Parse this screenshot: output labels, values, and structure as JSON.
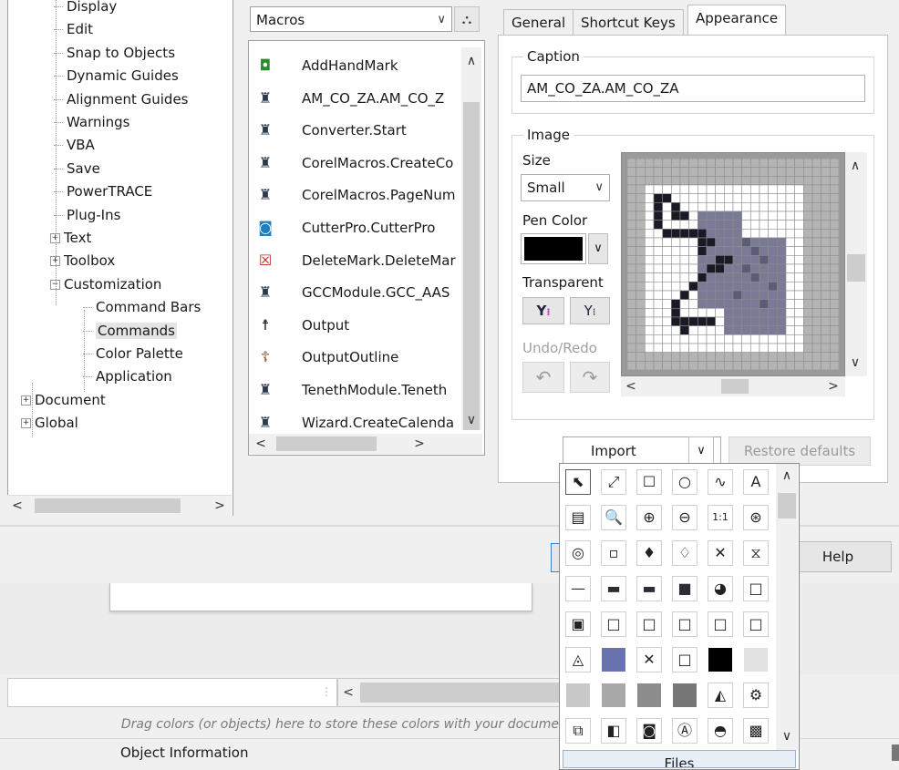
{
  "tree": {
    "items": [
      {
        "label": "Display",
        "level": 1
      },
      {
        "label": "Edit",
        "level": 1
      },
      {
        "label": "Snap to Objects",
        "level": 1
      },
      {
        "label": "Dynamic Guides",
        "level": 1
      },
      {
        "label": "Alignment Guides",
        "level": 1
      },
      {
        "label": "Warnings",
        "level": 1
      },
      {
        "label": "VBA",
        "level": 1
      },
      {
        "label": "Save",
        "level": 1
      },
      {
        "label": "PowerTRACE",
        "level": 1
      },
      {
        "label": "Plug-Ins",
        "level": 1
      },
      {
        "label": "Text",
        "level": 1,
        "expander": "+"
      },
      {
        "label": "Toolbox",
        "level": 1,
        "expander": "+"
      },
      {
        "label": "Customization",
        "level": 1,
        "expander": "−"
      },
      {
        "label": "Command Bars",
        "level": 2
      },
      {
        "label": "Commands",
        "level": 2,
        "selected": true
      },
      {
        "label": "Color Palette",
        "level": 2
      },
      {
        "label": "Application",
        "level": 2
      },
      {
        "label": "Document",
        "level": 0,
        "expander": "+"
      },
      {
        "label": "Global",
        "level": 0,
        "expander": "+"
      }
    ]
  },
  "macros": {
    "category": "Macros",
    "items": [
      {
        "label": "AddHandMark",
        "icon": "hand-mark-icon",
        "glyph": "◘",
        "color": "#2d8a2d"
      },
      {
        "label": "AM_CO_ZA.AM_CO_Z",
        "icon": "macro-runner-icon",
        "glyph": "♜",
        "color": "#2a3a4a"
      },
      {
        "label": "Converter.Start",
        "icon": "macro-runner-icon",
        "glyph": "♜",
        "color": "#2a3a4a"
      },
      {
        "label": "CorelMacros.CreateCo",
        "icon": "macro-runner-icon",
        "glyph": "♜",
        "color": "#2a3a4a"
      },
      {
        "label": "CorelMacros.PageNum",
        "icon": "macro-runner-icon",
        "glyph": "♜",
        "color": "#2a3a4a"
      },
      {
        "label": "CutterPro.CutterPro",
        "icon": "cutter-icon",
        "glyph": "◙",
        "color": "#1f7fbf"
      },
      {
        "label": "DeleteMark.DeleteMar",
        "icon": "delete-mark-icon",
        "glyph": "☒",
        "color": "#c02020"
      },
      {
        "label": "GCCModule.GCC_AAS",
        "icon": "macro-runner-icon",
        "glyph": "♜",
        "color": "#2a3a4a"
      },
      {
        "label": "Output",
        "icon": "output-icon",
        "glyph": "☨",
        "color": "#222222"
      },
      {
        "label": "OutputOutline",
        "icon": "output-outline-icon",
        "glyph": "☦",
        "color": "#8a4a20"
      },
      {
        "label": "TenethModule.Teneth",
        "icon": "macro-runner-icon",
        "glyph": "♜",
        "color": "#2a3a4a"
      },
      {
        "label": "Wizard.CreateCalenda",
        "icon": "macro-runner-icon",
        "glyph": "♜",
        "color": "#2a3a4a"
      }
    ]
  },
  "tabs": [
    {
      "label": "General"
    },
    {
      "label": "Shortcut Keys"
    },
    {
      "label": "Appearance",
      "active": true
    }
  ],
  "appearance": {
    "caption_legend": "Caption",
    "caption_value": "AM_CO_ZA.AM_CO_ZA",
    "image_legend": "Image",
    "size_label": "Size",
    "size_value": "Small",
    "pen_color_label": "Pen Color",
    "pen_color": "#000000",
    "transparent_label": "Transparent",
    "undo_redo_label": "Undo/Redo",
    "import_label": "Import",
    "restore_label": "Restore defaults"
  },
  "dialog": {
    "help_label": "Help"
  },
  "popup": {
    "files_label": "Files"
  },
  "statusbar": {
    "drop_hint": "Drag colors (or objects) here to store these colors with your docume",
    "object_info": "Object Information"
  }
}
